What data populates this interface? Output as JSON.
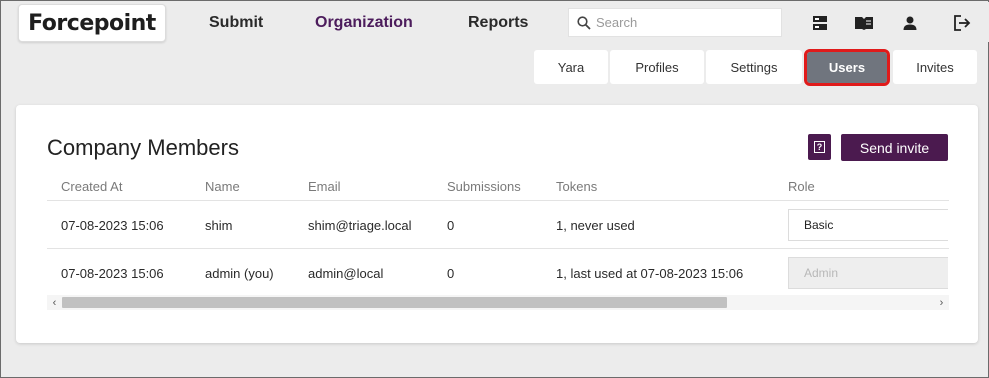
{
  "brand": {
    "logo_text": "Forcepoint"
  },
  "nav": {
    "submit": "Submit",
    "organization": "Organization",
    "reports": "Reports"
  },
  "search": {
    "placeholder": "Search",
    "value": ""
  },
  "header_icons": [
    "dashboard-icon",
    "book-icon",
    "user-icon",
    "logout-icon"
  ],
  "subtabs": [
    {
      "label": "Yara",
      "active": false
    },
    {
      "label": "Profiles",
      "active": false
    },
    {
      "label": "Settings",
      "active": false
    },
    {
      "label": "Users",
      "active": true
    },
    {
      "label": "Invites",
      "active": false
    }
  ],
  "members": {
    "title": "Company Members",
    "help_label": "?",
    "send_invite": "Send invite",
    "columns": [
      "Created At",
      "Name",
      "Email",
      "Submissions",
      "Tokens",
      "Role"
    ],
    "rows": [
      {
        "created_at": "07-08-2023 15:06",
        "name": "shim",
        "email": "shim@triage.local",
        "submissions": "0",
        "tokens": "1, never used",
        "role": "Basic",
        "role_disabled": false
      },
      {
        "created_at": "07-08-2023 15:06",
        "name": "admin (you)",
        "email": "admin@local",
        "submissions": "0",
        "tokens": "1, last used at 07-08-2023 15:06",
        "role": "Admin",
        "role_disabled": true
      }
    ]
  },
  "scrollbar": {
    "left_arrow": "‹",
    "right_arrow": "›"
  },
  "colors": {
    "brand_purple": "#4b1a4f",
    "active_tab_bg": "#70757e",
    "highlight_border": "#e01b1b",
    "nav_active": "#4c1c5c"
  }
}
